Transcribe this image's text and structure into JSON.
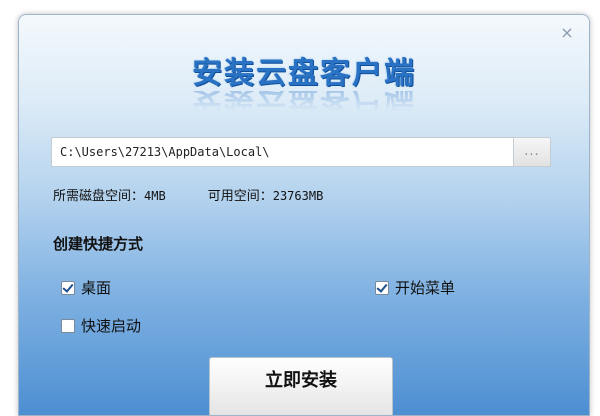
{
  "window": {
    "title": "安装云盘客户端",
    "close_glyph": "×"
  },
  "path": {
    "value": "C:\\Users\\27213\\AppData\\Local\\",
    "browse_label": "..."
  },
  "space": {
    "required_label": "所需磁盘空间：",
    "required_value": "4MB",
    "available_label": "可用空间：",
    "available_value": "23763MB"
  },
  "shortcuts": {
    "title": "创建快捷方式",
    "desktop": {
      "label": "桌面",
      "checked": true
    },
    "start_menu": {
      "label": "开始菜单",
      "checked": true
    },
    "quick_launch": {
      "label": "快速启动",
      "checked": false
    }
  },
  "install_button": {
    "label": "立即安装"
  },
  "colors": {
    "title_blue": "#2a72c4",
    "bg_bottom": "#4d8fd2"
  },
  "icons": {
    "close": "close-icon",
    "checkmark": "checkmark-icon"
  }
}
